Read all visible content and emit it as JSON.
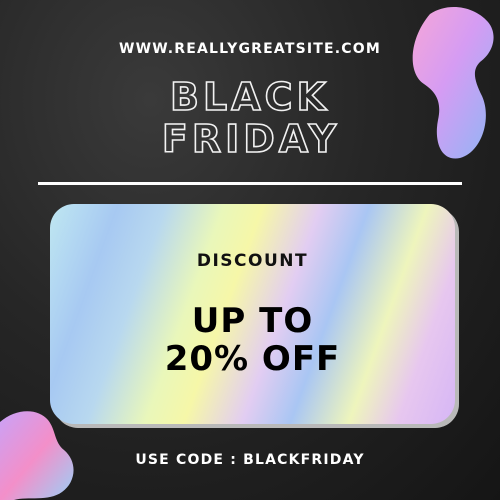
{
  "website": "WWW.REALLYGREATSITE.COM",
  "headline": {
    "line1": "BLACK",
    "line2": "FRIDAY"
  },
  "card": {
    "label": "DISCOUNT",
    "offer_line1": "UP TO",
    "offer_line2": "20% OFF"
  },
  "promo": {
    "code_text": "USE CODE : BLACKFRIDAY"
  },
  "colors": {
    "background": "#1e1e1e",
    "text_light": "#ffffff",
    "text_dark": "#000000",
    "blob_pink": "#f38fc9",
    "blob_blue": "#8fb6f5",
    "blob_purple": "#c9a2f7"
  }
}
